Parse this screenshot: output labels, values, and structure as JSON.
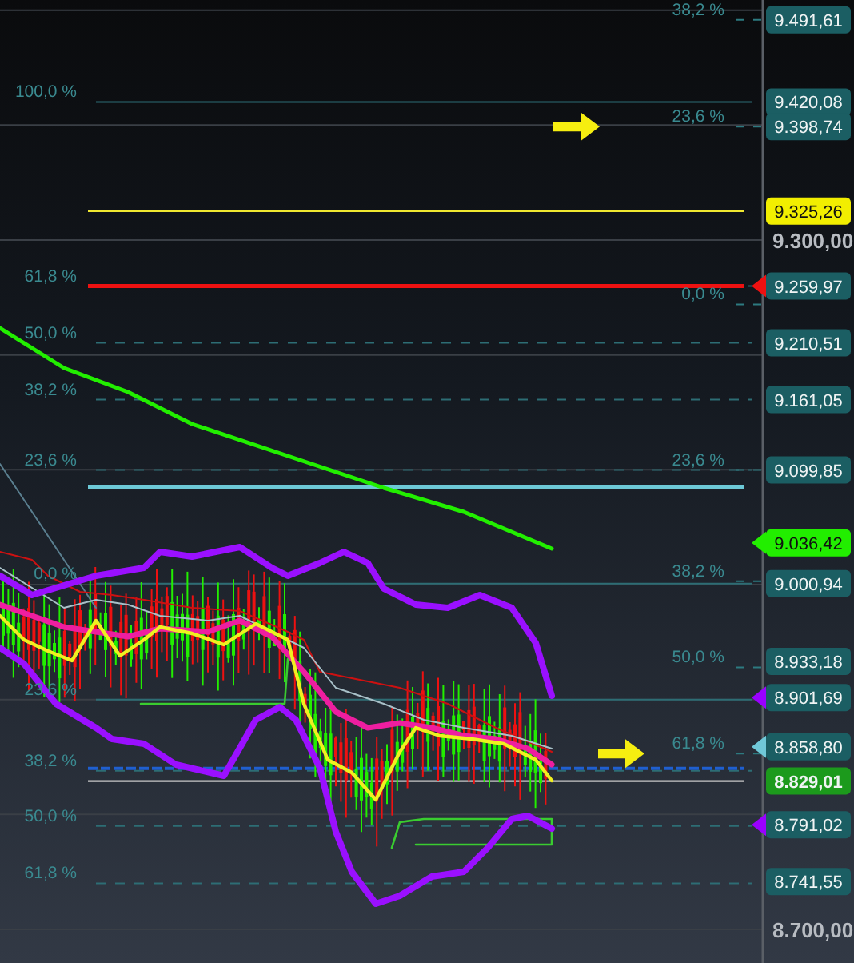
{
  "price_axis": {
    "labels": [
      "9.300,00",
      "8.700,00"
    ]
  },
  "left_levels": [
    {
      "text": "100,0 %"
    },
    {
      "text": "61,8 %"
    },
    {
      "text": "50,0 %"
    },
    {
      "text": "38,2 %"
    },
    {
      "text": "23,6 %"
    },
    {
      "text": "0,0 %"
    },
    {
      "text": "23,6 %"
    },
    {
      "text": "38,2 %"
    },
    {
      "text": "50,0 %"
    },
    {
      "text": "61,8 %"
    }
  ],
  "right_levels": [
    {
      "text": "38,2 %"
    },
    {
      "text": "23,6 %"
    },
    {
      "text": "0,0 %"
    },
    {
      "text": "23,6 %"
    },
    {
      "text": "38,2 %"
    },
    {
      "text": "50,0 %"
    },
    {
      "text": "61,8 %"
    }
  ],
  "price_tags": [
    {
      "text": "9.491,61",
      "color": "#1b5e63"
    },
    {
      "text": "9.420,08",
      "color": "#1b5e63"
    },
    {
      "text": "9.398,74",
      "color": "#1b5e63"
    },
    {
      "text": "9.325,26",
      "color": "#f2ee00"
    },
    {
      "text": "9.259,97",
      "color": "#1b5e63",
      "pointer": {
        "color": "#ee1111"
      }
    },
    {
      "text": "9.210,51",
      "color": "#1b5e63"
    },
    {
      "text": "9.161,05",
      "color": "#1b5e63"
    },
    {
      "text": "9.099,85",
      "color": "#1b5e63"
    },
    {
      "text": "9.036,42",
      "color": "#22ee00",
      "pointer": {
        "color": "#22ee00"
      }
    },
    {
      "text": "9.000,94",
      "color": "#1b5e63"
    },
    {
      "text": "8.933,18",
      "color": "#1b5e63"
    },
    {
      "text": "8.901,69",
      "color": "#1b5e63",
      "pointer": {
        "color": "#9a00ff"
      }
    },
    {
      "text": "8.858,80",
      "color": "#1b5e63",
      "pointer": {
        "color": "#70c8d8"
      }
    },
    {
      "text": "8.829,01",
      "color": "#1c9a1c"
    },
    {
      "text": "8.791,02",
      "color": "#1b5e63",
      "pointer": {
        "color": "#9a00ff"
      }
    },
    {
      "text": "8.741,55",
      "color": "#1b5e63"
    }
  ]
}
